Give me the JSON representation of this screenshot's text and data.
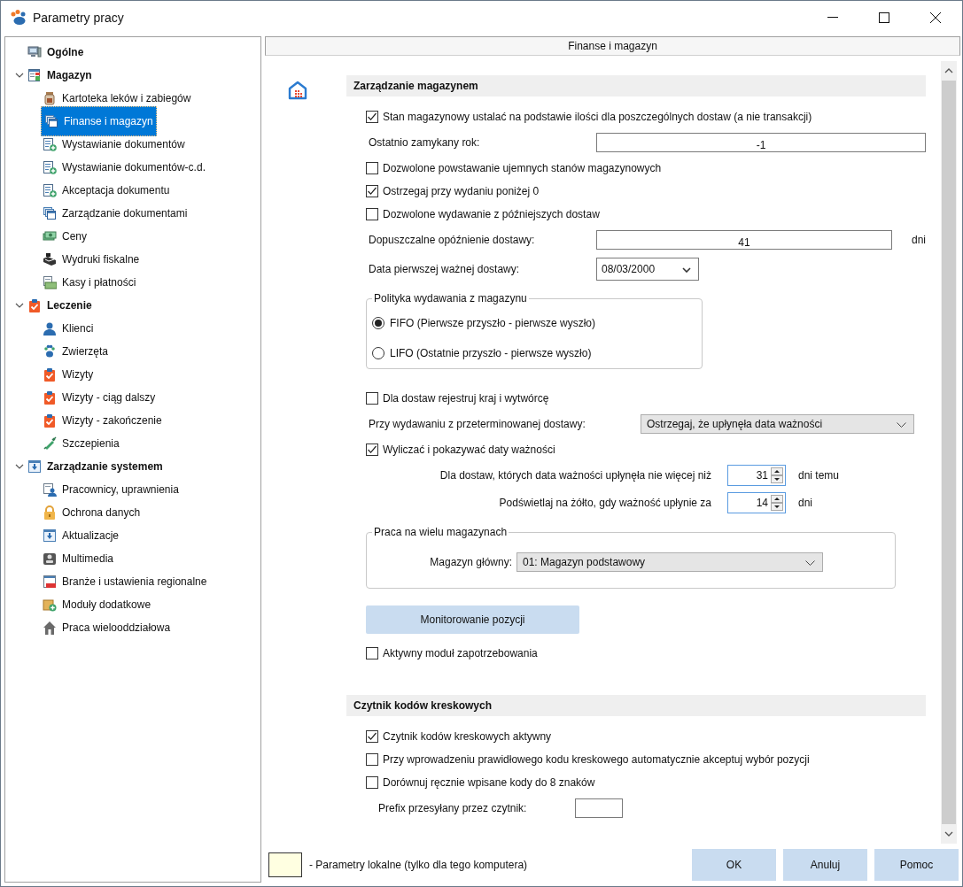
{
  "window": {
    "title": "Parametry pracy"
  },
  "sidebar": {
    "items": [
      {
        "label": "Ogólne",
        "selected": false
      },
      {
        "label": "Magazyn",
        "selected": false,
        "expanded": true,
        "children": [
          {
            "label": "Kartoteka leków i zabiegów",
            "selected": false
          },
          {
            "label": "Finanse i magazyn",
            "selected": true
          },
          {
            "label": "Wystawianie dokumentów",
            "selected": false
          },
          {
            "label": "Wystawianie dokumentów-c.d.",
            "selected": false
          },
          {
            "label": "Akceptacja dokumentu",
            "selected": false
          },
          {
            "label": "Zarządzanie dokumentami",
            "selected": false
          },
          {
            "label": "Ceny",
            "selected": false
          },
          {
            "label": "Wydruki fiskalne",
            "selected": false
          },
          {
            "label": "Kasy i płatności",
            "selected": false
          }
        ]
      },
      {
        "label": "Leczenie",
        "selected": false,
        "expanded": true,
        "children": [
          {
            "label": "Klienci",
            "selected": false
          },
          {
            "label": "Zwierzęta",
            "selected": false
          },
          {
            "label": "Wizyty",
            "selected": false
          },
          {
            "label": "Wizyty - ciąg dalszy",
            "selected": false
          },
          {
            "label": "Wizyty - zakończenie",
            "selected": false
          },
          {
            "label": "Szczepienia",
            "selected": false
          }
        ]
      },
      {
        "label": "Zarządzanie systemem",
        "selected": false,
        "expanded": true,
        "children": [
          {
            "label": "Pracownicy, uprawnienia",
            "selected": false
          },
          {
            "label": "Ochrona danych",
            "selected": false
          },
          {
            "label": "Aktualizacje",
            "selected": false
          },
          {
            "label": "Multimedia",
            "selected": false
          },
          {
            "label": "Branże i ustawienia regionalne",
            "selected": false
          },
          {
            "label": "Moduły dodatkowe",
            "selected": false
          },
          {
            "label": "Praca wielooddziałowa",
            "selected": false
          }
        ]
      }
    ]
  },
  "settings": {
    "title": "Finanse i magazyn",
    "sections": [
      {
        "title": "Zarządzanie magazynem",
        "rows": [
          {
            "kind": "checkbox",
            "label": "Stan magazynowy ustalać na podstawie ilości dla poszczególnych dostaw (a nie transakcji)",
            "checked": true
          },
          {
            "kind": "number",
            "label": "Ostatnio zamykany rok:",
            "value": "-1"
          },
          {
            "kind": "checkbox",
            "label": "Dozwolone powstawanie ujemnych stanów magazynowych",
            "checked": false
          },
          {
            "kind": "checkbox",
            "label": "Ostrzegaj przy wydaniu poniżej 0",
            "checked": true
          },
          {
            "kind": "checkbox",
            "label": "Dozwolone wydawanie z późniejszych dostaw",
            "checked": false
          },
          {
            "kind": "number",
            "label": "Dopuszczalne opóźnienie dostawy:",
            "value": "41",
            "unit": "dni"
          },
          {
            "kind": "date",
            "label": "Data pierwszej ważnej dostawy:",
            "value": "08/03/2000"
          },
          {
            "kind": "radios",
            "legend": "Polityka wydawania z magazynu",
            "options": [
              {
                "label": "FIFO (Pierwsze przyszło - pierwsze wyszło)",
                "selected": true
              },
              {
                "label": "LIFO (Ostatnie przyszło - pierwsze wyszło)",
                "selected": false
              }
            ]
          },
          {
            "kind": "checkbox",
            "label": "Dla dostaw rejestruj kraj i wytwórcę",
            "checked": false
          },
          {
            "kind": "select",
            "label": "Przy wydawaniu z przeterminowanej dostawy:",
            "value": "Ostrzegaj, że upłynęła data ważności"
          },
          {
            "kind": "checkbox",
            "label": "Wyliczać i pokazywać daty ważności",
            "checked": true
          },
          {
            "kind": "spinner",
            "label": "Dla dostaw, których data ważności upłynęła  nie więcej niż",
            "value": "31",
            "unit": "dni temu"
          },
          {
            "kind": "spinner",
            "label": "Podświetlaj na żółto, gdy ważność upłynie za",
            "value": "14",
            "unit": "dni"
          },
          {
            "kind": "group",
            "legend": "Praca na wielu magazynach",
            "label": "Magazyn główny:",
            "value": "01: Magazyn podstawowy"
          },
          {
            "kind": "button",
            "label": "Monitorowanie pozycji"
          },
          {
            "kind": "checkbox",
            "label": "Aktywny moduł zapotrzebowania",
            "checked": false
          }
        ]
      },
      {
        "title": "Czytnik kodów kreskowych",
        "rows": [
          {
            "kind": "checkbox",
            "label": "Czytnik kodów kreskowych aktywny",
            "checked": true
          },
          {
            "kind": "checkbox",
            "label": "Przy wprowadzeniu prawidłowego kodu kreskowego automatycznie akceptuj wybór pozycji",
            "checked": false
          },
          {
            "kind": "checkbox",
            "label": "Dorównuj ręcznie wpisane kody do 8 znaków",
            "checked": false
          },
          {
            "kind": "text",
            "label": "Prefix przesyłany przez czytnik:"
          }
        ]
      }
    ]
  },
  "footer": {
    "legend": "- Parametry lokalne (tylko dla tego komputera)",
    "buttons": [
      "OK",
      "Anuluj",
      "Pomoc"
    ]
  }
}
